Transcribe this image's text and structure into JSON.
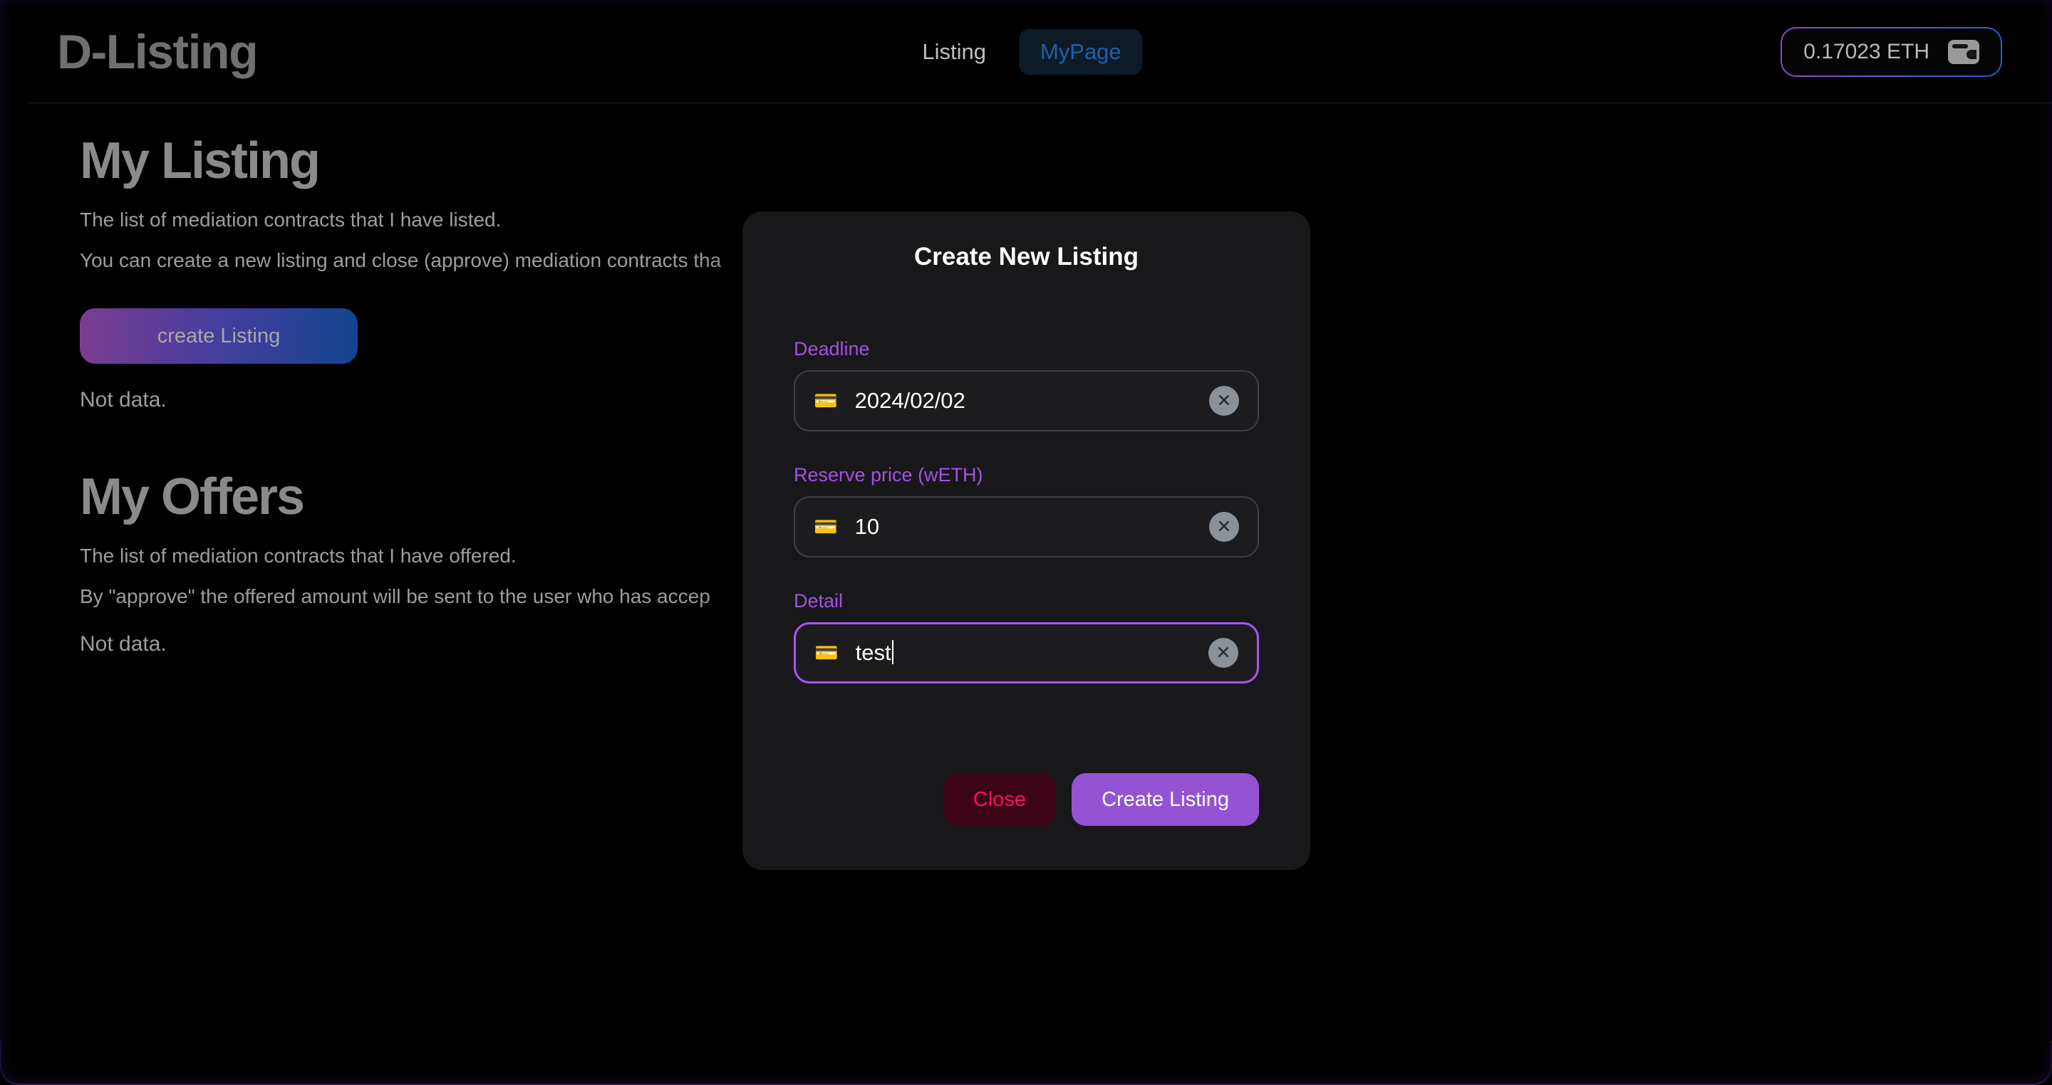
{
  "header": {
    "brand": "D-Listing",
    "nav": [
      {
        "label": "Listing",
        "active": false
      },
      {
        "label": "MyPage",
        "active": true
      }
    ],
    "wallet": {
      "balance": "0.17023 ETH",
      "icon": "wallet-icon"
    }
  },
  "main": {
    "listing": {
      "title": "My Listing",
      "desc1": "The list of mediation contracts that I have listed.",
      "desc2": "You can create a new listing and close (approve) mediation contracts tha",
      "create_button": "create Listing",
      "empty": "Not data."
    },
    "offers": {
      "title": "My Offers",
      "desc1": "The list of mediation contracts that I have offered.",
      "desc2": "By \"approve\" the offered amount will be sent to the user who has accep",
      "empty": "Not data."
    }
  },
  "modal": {
    "title": "Create New Listing",
    "fields": [
      {
        "label": "Deadline",
        "value": "2024/02/02",
        "placeholder": "Deadline",
        "icon": "credit-card-icon",
        "icon_glyph": "💳",
        "focused": false,
        "clear_label": "✕"
      },
      {
        "label": "Reserve price (wETH)",
        "value": "10",
        "placeholder": "Reserve price",
        "icon": "credit-card-icon",
        "icon_glyph": "💳",
        "focused": false,
        "clear_label": "✕"
      },
      {
        "label": "Detail",
        "value": "test",
        "placeholder": "Detail",
        "icon": "credit-card-icon",
        "icon_glyph": "💳",
        "focused": true,
        "clear_label": "✕"
      }
    ],
    "close_button": "Close",
    "submit_button": "Create Listing"
  },
  "colors": {
    "page_bg": "#000000",
    "modal_bg": "#18181b",
    "accent_purple": "#a855f7",
    "label_purple": "#a252e0",
    "primary_button": "#9353d3",
    "danger_text": "#f31260",
    "danger_bg": "#3d0316",
    "nav_active_text": "#1a62ab",
    "nav_active_bg": "#0e1a26",
    "muted_text": "#8a8a8a",
    "gradient_start": "#7b3d8f",
    "gradient_end": "#12448f"
  }
}
